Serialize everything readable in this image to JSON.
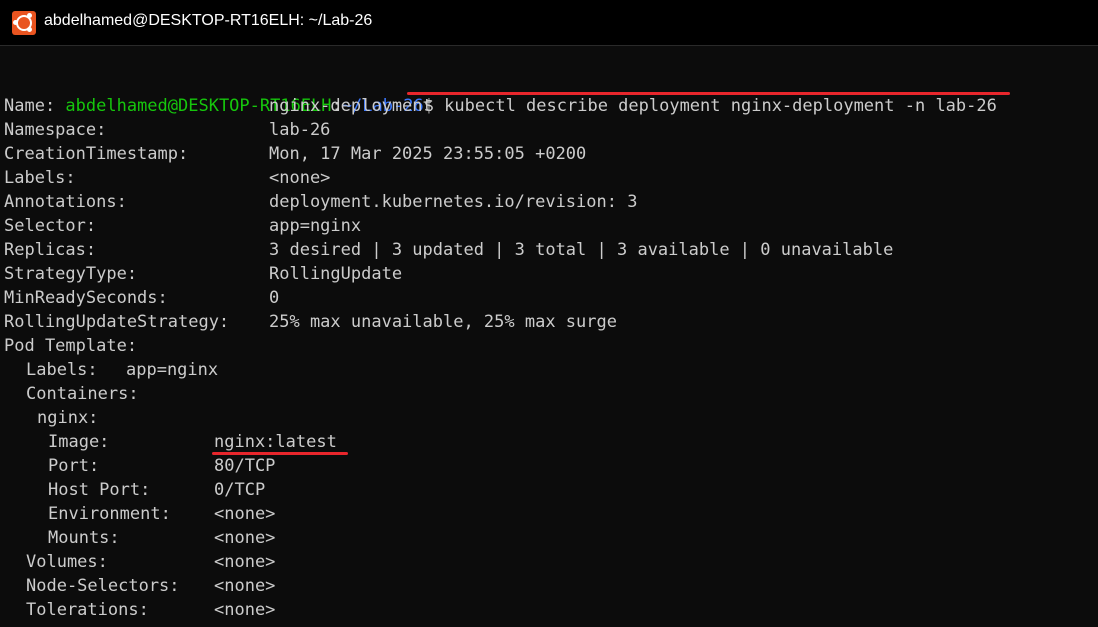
{
  "window": {
    "title": "abdelhamed@DESKTOP-RT16ELH: ~/Lab-26",
    "icon": "ubuntu-terminal-icon",
    "accent": "#e95420"
  },
  "prompt": {
    "user_host": "abdelhamed@DESKTOP-RT16ELH",
    "separator": ":",
    "path": "~/Lab-26",
    "symbol": "$",
    "command": "kubectl describe deployment nginx-deployment -n lab-26"
  },
  "output": [
    {
      "indent": 0,
      "key": "Name:",
      "value": "nginx-deployment"
    },
    {
      "indent": 0,
      "key": "Namespace:",
      "value": "lab-26"
    },
    {
      "indent": 0,
      "key": "CreationTimestamp:",
      "value": "Mon, 17 Mar 2025 23:55:05 +0200"
    },
    {
      "indent": 0,
      "key": "Labels:",
      "value": "<none>"
    },
    {
      "indent": 0,
      "key": "Annotations:",
      "value": "deployment.kubernetes.io/revision: 3"
    },
    {
      "indent": 0,
      "key": "Selector:",
      "value": "app=nginx"
    },
    {
      "indent": 0,
      "key": "Replicas:",
      "value": "3 desired | 3 updated | 3 total | 3 available | 0 unavailable"
    },
    {
      "indent": 0,
      "key": "StrategyType:",
      "value": "RollingUpdate"
    },
    {
      "indent": 0,
      "key": "MinReadySeconds:",
      "value": "0"
    },
    {
      "indent": 0,
      "key": "RollingUpdateStrategy:",
      "value": "25% max unavailable, 25% max surge"
    },
    {
      "indent": 0,
      "key": "Pod Template:",
      "value": ""
    },
    {
      "indent": 1,
      "key": "Labels:",
      "value": "app=nginx"
    },
    {
      "indent": 1,
      "key": "Containers:",
      "value": ""
    },
    {
      "indent": 2,
      "key": "nginx:",
      "value": ""
    },
    {
      "indent": 3,
      "key": "Image:",
      "value": "nginx:latest"
    },
    {
      "indent": 3,
      "key": "Port:",
      "value": "80/TCP"
    },
    {
      "indent": 3,
      "key": "Host Port:",
      "value": "0/TCP"
    },
    {
      "indent": 3,
      "key": "Environment:",
      "value": "<none>"
    },
    {
      "indent": 3,
      "key": "Mounts:",
      "value": "<none>"
    },
    {
      "indent": 1,
      "key": "Volumes:",
      "value": "<none>"
    },
    {
      "indent": 1,
      "key": "Node-Selectors:",
      "value": "<none>"
    },
    {
      "indent": 1,
      "key": "Tolerations:",
      "value": "<none>"
    }
  ],
  "colors": {
    "background": "#0c0c0c",
    "text": "#cccccc",
    "prompt_user": "#16c60c",
    "prompt_path": "#3b78ff",
    "annotation_underline": "#e8262c"
  }
}
